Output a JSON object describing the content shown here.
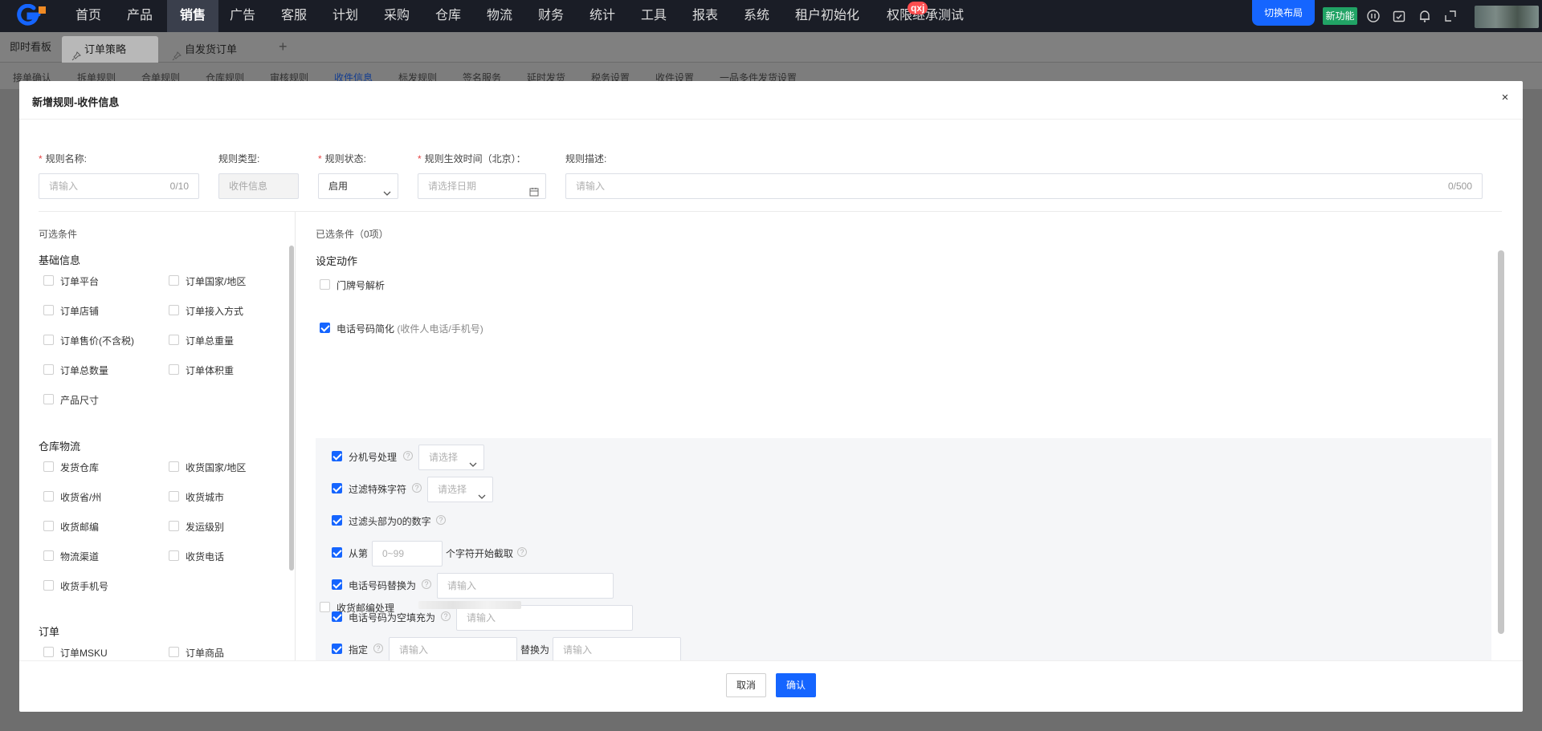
{
  "topbar": {
    "nav": [
      "首页",
      "产品",
      "销售",
      "广告",
      "客服",
      "计划",
      "采购",
      "仓库",
      "物流",
      "财务",
      "统计",
      "工具",
      "报表",
      "系统",
      "租户初始化",
      "权限继承测试"
    ],
    "active_nav": "销售",
    "badge": "qxj",
    "switch_layout": "切换布局",
    "new_feature": "新功能",
    "icons": [
      "info-icon",
      "check-calendar-icon",
      "bell-icon",
      "fullscreen-icon"
    ],
    "colors": {
      "bar": "#1a1d26",
      "switch": "#1565ff",
      "new": "#21a365",
      "badge": "#ff4d4f"
    }
  },
  "tabs": {
    "dashboard": "即时看板",
    "items": [
      "订单策略",
      "自发货订单"
    ],
    "active": "订单策略",
    "add": "+"
  },
  "subtabs": [
    "接单确认",
    "拆单规则",
    "合单规则",
    "仓库规则",
    "审核规则",
    "收件信息",
    "标发规则",
    "签名服务",
    "延时发货",
    "税务设置",
    "收件设置",
    "一品多件发货设置"
  ],
  "active_subtab": "收件信息",
  "modal": {
    "title": "新增规则-收件信息",
    "close": "×",
    "form": {
      "name_label": "规则名称:",
      "name_placeholder": "请输入",
      "name_count": "0/10",
      "type_label": "规则类型:",
      "type_value": "收件信息",
      "status_label": "规则状态:",
      "status_value": "启用",
      "time_label": "规则生效时间（北京）：",
      "time_placeholder": "请选择日期",
      "desc_label": "规则描述:",
      "desc_placeholder": "请输入",
      "desc_count": "0/500",
      "required_mark": "*"
    },
    "left": {
      "title": "可选条件",
      "groups": [
        {
          "title": "基础信息",
          "items": [
            "订单平台",
            "订单国家/地区",
            "订单店铺",
            "订单接入方式",
            "订单售价(不含税)",
            "订单总重量",
            "订单总数量",
            "订单体积重",
            "产品尺寸"
          ]
        },
        {
          "title": "仓库物流",
          "items": [
            "发货仓库",
            "收货国家/地区",
            "收货省/州",
            "收货城市",
            "收货邮编",
            "发运级别",
            "物流渠道",
            "收货电话",
            "收货手机号"
          ]
        },
        {
          "title": "订单",
          "items": [
            "订单MSKU",
            "订单商品"
          ]
        }
      ]
    },
    "right": {
      "title": "已选条件（0项）",
      "action_title": "设定动作",
      "door_parse": "门牌号解析",
      "phone_simplify": "电话号码简化",
      "phone_hint": "(收件人电话/手机号)",
      "ext": "分机号处理",
      "filter_special": "过滤特殊字符",
      "select_placeholder": "请选择",
      "filter_zero": "过滤头部为0的数字",
      "from_label": "从第",
      "from_placeholder": "0~99",
      "from_suffix": "个字符开始截取",
      "replace_label": "电话号码替换为",
      "empty_label": "电话号码为空填充为",
      "specify_label": "指定",
      "replace_with": "替换为",
      "input_placeholder": "请输入",
      "zip_process": "收货邮编处理",
      "help": "?"
    },
    "footer": {
      "cancel": "取消",
      "confirm": "确认"
    }
  }
}
